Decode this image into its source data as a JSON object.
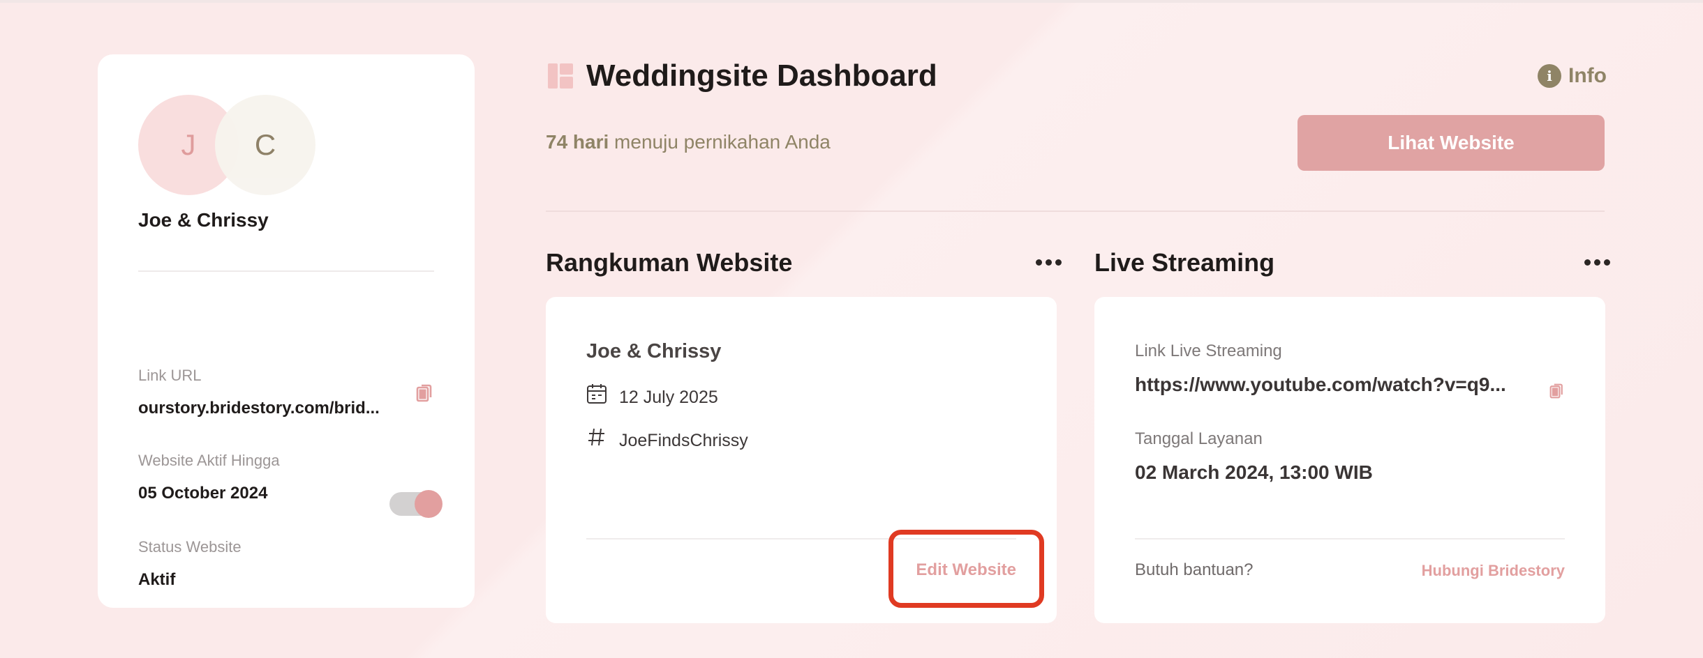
{
  "profile": {
    "avatar_initial_1": "J",
    "avatar_initial_2": "C",
    "couple_name": "Joe & Chrissy",
    "link_url_label": "Link URL",
    "link_url_value": "ourstory.bridestory.com/brid...",
    "active_until_label": "Website Aktif Hingga",
    "active_until_value": "05 October 2024",
    "status_label": "Status Website",
    "status_value": "Aktif",
    "status_toggle_on": true
  },
  "header": {
    "title": "Weddingsite Dashboard",
    "info_label": "Info",
    "countdown_days": "74 hari",
    "countdown_rest": " menuju pernikahan Anda",
    "view_website_button": "Lihat Website"
  },
  "summary": {
    "section_title": "Rangkuman Website",
    "couple_name": "Joe & Chrissy",
    "date": "12 July 2025",
    "hashtag": "JoeFindsChrissy",
    "edit_button": "Edit Website"
  },
  "live_streaming": {
    "section_title": "Live Streaming",
    "link_label": "Link Live Streaming",
    "link_value": "https://www.youtube.com/watch?v=q9...",
    "service_date_label": "Tanggal Layanan",
    "service_date_value": "02 March 2024, 13:00 WIB",
    "help_text": "Butuh bantuan?",
    "contact_link": "Hubungi Bridestory"
  },
  "colors": {
    "accent": "#e29f9f",
    "olive": "#8f8466",
    "background": "#fbeaea",
    "highlight": "#e03a22"
  }
}
